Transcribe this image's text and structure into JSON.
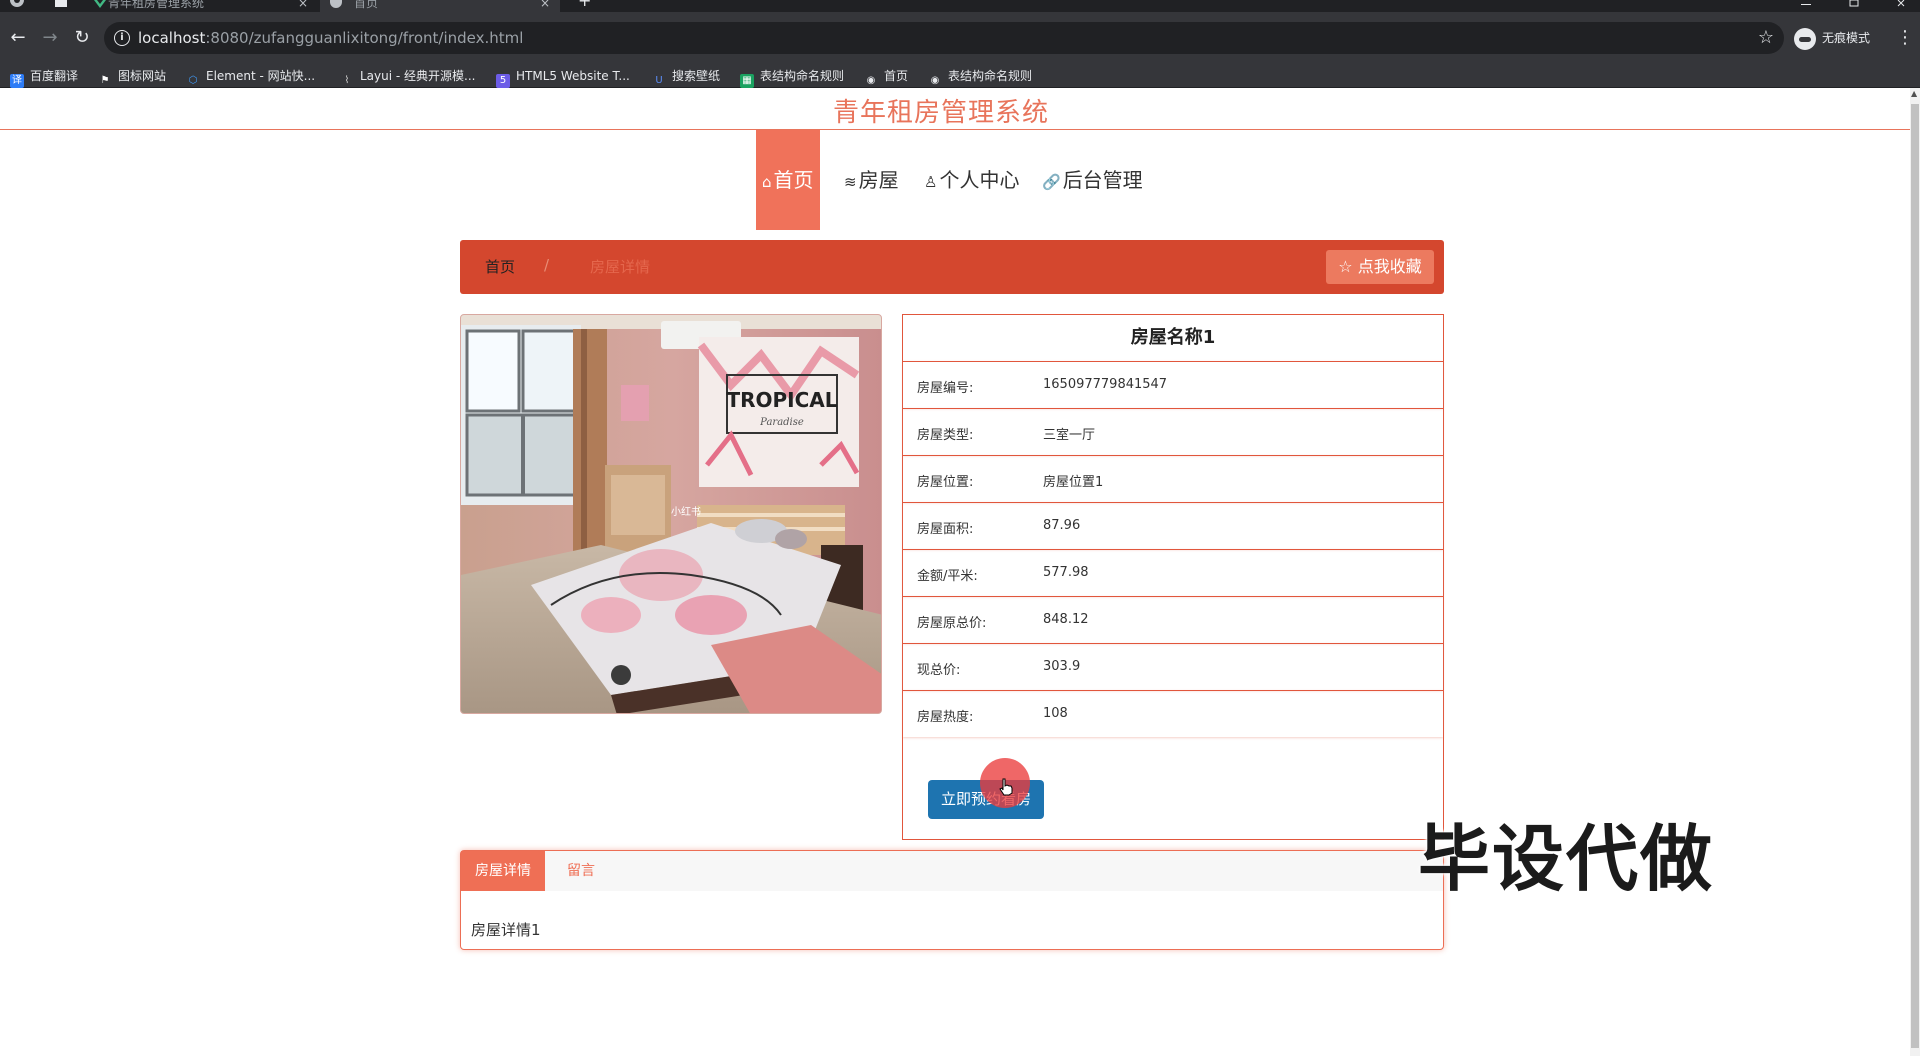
{
  "browser": {
    "tabs": [
      {
        "label": "青年租房管理系统",
        "close": "×"
      },
      {
        "label": "首页",
        "close": "×"
      }
    ],
    "new_tab": "+",
    "url_host": "localhost",
    "url_rest": ":8080/zufangguanlixitong/front/index.html",
    "incognito_label": "无痕模式",
    "bookmarks": [
      {
        "label": "百度翻译",
        "icon": "translate-icon",
        "color": "#2d7cf6"
      },
      {
        "label": "图标网站",
        "icon": "flag-icon",
        "color": "#ffffff"
      },
      {
        "label": "Element - 网站快...",
        "icon": "element-icon",
        "color": "#409eff"
      },
      {
        "label": "Layui - 经典开源模...",
        "icon": "layui-icon",
        "color": "#cccccc"
      },
      {
        "label": "HTML5 Website T...",
        "icon": "html5-icon",
        "color": "#6c5ce7"
      },
      {
        "label": "搜索壁纸",
        "icon": "wallpaper-icon",
        "color": "#3b6ad6"
      },
      {
        "label": "表结构命名规则",
        "icon": "sheet-icon",
        "color": "#1aa260"
      },
      {
        "label": "首页",
        "icon": "globe-icon",
        "color": "#e8eaed"
      },
      {
        "label": "表结构命名规则",
        "icon": "globe-icon",
        "color": "#e8eaed"
      }
    ]
  },
  "site": {
    "title": "青年租房管理系统",
    "nav": [
      {
        "label": "首页",
        "icon": "⌂"
      },
      {
        "label": "房屋",
        "icon": "≋"
      },
      {
        "label": "个人中心",
        "icon": "♙"
      },
      {
        "label": "后台管理",
        "icon": "🔗"
      }
    ],
    "breadcrumb": {
      "home": "首页",
      "separator": "/",
      "current": "房屋详情"
    },
    "favorite_label": "☆ 点我收藏",
    "photo_sign_text": "TROPICAL",
    "photo_sign_script": "Paradise",
    "photo_tag": "小红书",
    "house": {
      "name": "房屋名称1",
      "fields": [
        {
          "key": "房屋编号:",
          "value": "165097779841547"
        },
        {
          "key": "房屋类型:",
          "value": "三室一厅"
        },
        {
          "key": "房屋位置:",
          "value": "房屋位置1"
        },
        {
          "key": "房屋面积:",
          "value": "87.96"
        },
        {
          "key": "金额/平米:",
          "value": "577.98"
        },
        {
          "key": "房屋原总价:",
          "value": "848.12"
        },
        {
          "key": "现总价:",
          "value": "303.9"
        },
        {
          "key": "房屋热度:",
          "value": "108"
        }
      ]
    },
    "rent_button": "立即预约看房",
    "tabs": [
      {
        "label": "房屋详情"
      },
      {
        "label": "留言"
      }
    ],
    "detail_text": "房屋详情1"
  },
  "overlay": {
    "watermark": "毕设代做"
  },
  "colors": {
    "accent": "#f0725a",
    "crumb_bg": "#d4472e",
    "button_blue": "#1e74b0",
    "border": "#e1563c"
  }
}
